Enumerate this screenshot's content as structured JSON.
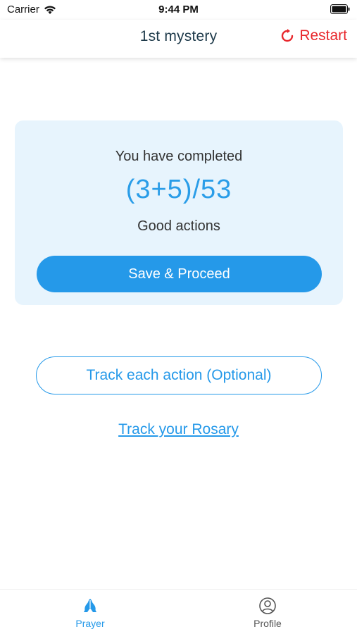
{
  "status_bar": {
    "carrier": "Carrier",
    "time": "9:44 PM"
  },
  "header": {
    "title": "1st mystery",
    "restart_label": "Restart",
    "restart_color": "#e8272c"
  },
  "progress_card": {
    "completed_label": "You have completed",
    "count": "(3+5)/53",
    "actions_label": "Good actions",
    "save_button_label": "Save & Proceed"
  },
  "actions": {
    "track_each_label": "Track each action (Optional)",
    "track_rosary_label": "Track your Rosary"
  },
  "tab_bar": {
    "tabs": [
      {
        "label": "Prayer",
        "icon": "praying-hands-icon",
        "active": true
      },
      {
        "label": "Profile",
        "icon": "user-circle-icon",
        "active": false
      }
    ]
  },
  "colors": {
    "accent": "#2599e9",
    "card_background": "#e7f4fd",
    "title": "#1e3a4a"
  }
}
